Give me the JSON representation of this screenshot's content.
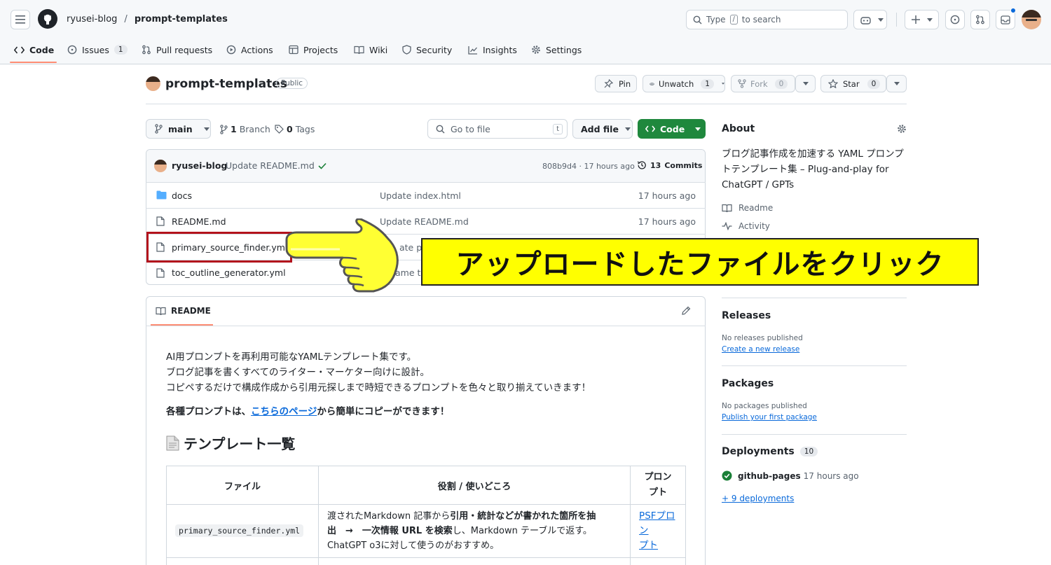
{
  "header": {
    "owner": "ryusei-blog",
    "separator": "/",
    "repo": "prompt-templates",
    "search_prefix": "Type",
    "search_key": "/",
    "search_suffix": "to search"
  },
  "nav": {
    "code": "Code",
    "issues": "Issues",
    "issues_count": "1",
    "pulls": "Pull requests",
    "actions": "Actions",
    "projects": "Projects",
    "wiki": "Wiki",
    "security": "Security",
    "insights": "Insights",
    "settings": "Settings"
  },
  "repo_head": {
    "name": "prompt-templates",
    "visibility": "Public",
    "pin": "Pin",
    "unwatch": "Unwatch",
    "watch_count": "1",
    "fork": "Fork",
    "fork_count": "0",
    "star": "Star",
    "star_count": "0"
  },
  "toolbar": {
    "branch": "main",
    "branches_count": "1",
    "branches_label": "Branch",
    "tags_count": "0",
    "tags_label": "Tags",
    "goto_placeholder": "Go to file",
    "goto_key": "t",
    "add_file": "Add file",
    "code": "Code"
  },
  "commit": {
    "author": "ryusei-blog",
    "message": "Update README.md",
    "hash_time": "808b9d4 · 17 hours ago",
    "commits_count": "13",
    "commits_label": "Commits"
  },
  "files": [
    {
      "name": "docs",
      "message": "Update index.html",
      "time": "17 hours ago",
      "type": "folder"
    },
    {
      "name": "README.md",
      "message": "Update README.md",
      "time": "17 hours ago",
      "type": "file"
    },
    {
      "name": "primary_source_finder.yml",
      "message": "ate pri",
      "time": "",
      "type": "file"
    },
    {
      "name": "toc_outline_generator.yml",
      "message": "ame to",
      "time": "",
      "type": "file"
    }
  ],
  "annotation": {
    "callout": "アップロードしたファイルをクリック",
    "highlight_color": "#b3121c",
    "callout_bg": "#ffff00"
  },
  "readme": {
    "tab": "README",
    "line1": "AI用プロンプトを再利用可能なYAMLテンプレート集です。",
    "line2": "ブログ記事を書くすべてのライター・マーケター向けに設計。",
    "line3": "コピペするだけで構成作成から引用元探しまで時短できるプロンプトを色々と取り揃えていきます！",
    "bold_prefix": "各種プロンプトは、",
    "bold_link": "こちらのページ",
    "bold_suffix": "から簡単にコピーができます！",
    "section_title": "テンプレート一覧",
    "table": {
      "headers": [
        "ファイル",
        "役割 / 使いどころ",
        "プロン\nプト"
      ],
      "row1": {
        "file": "primary_source_finder.yml",
        "desc_a": "渡されたMarkdown 記事から",
        "desc_b": "引用・統計などが書かれた箇所を抽",
        "desc_c": "出　→　一次情報 URL を検索",
        "desc_d": "し、Markdown テーブルで返す。",
        "desc_e": "ChatGPT o3に対して使うのがおすすめ。",
        "link_a": "PSFプロン",
        "link_b": "プト"
      }
    }
  },
  "sidebar": {
    "about_title": "About",
    "description": "ブログ記事作成を加速する YAML プロンプトテンプレート集 – Plug-and-play for ChatGPT / GPTs",
    "readme": "Readme",
    "activity": "Activity",
    "releases_title": "Releases",
    "releases_none": "No releases published",
    "releases_link": "Create a new release",
    "packages_title": "Packages",
    "packages_none": "No packages published",
    "packages_link": "Publish your first package",
    "deployments_title": "Deployments",
    "deployments_count": "10",
    "deploy_name": "github-pages",
    "deploy_time": "17 hours ago",
    "more_deployments": "+ 9 deployments"
  }
}
